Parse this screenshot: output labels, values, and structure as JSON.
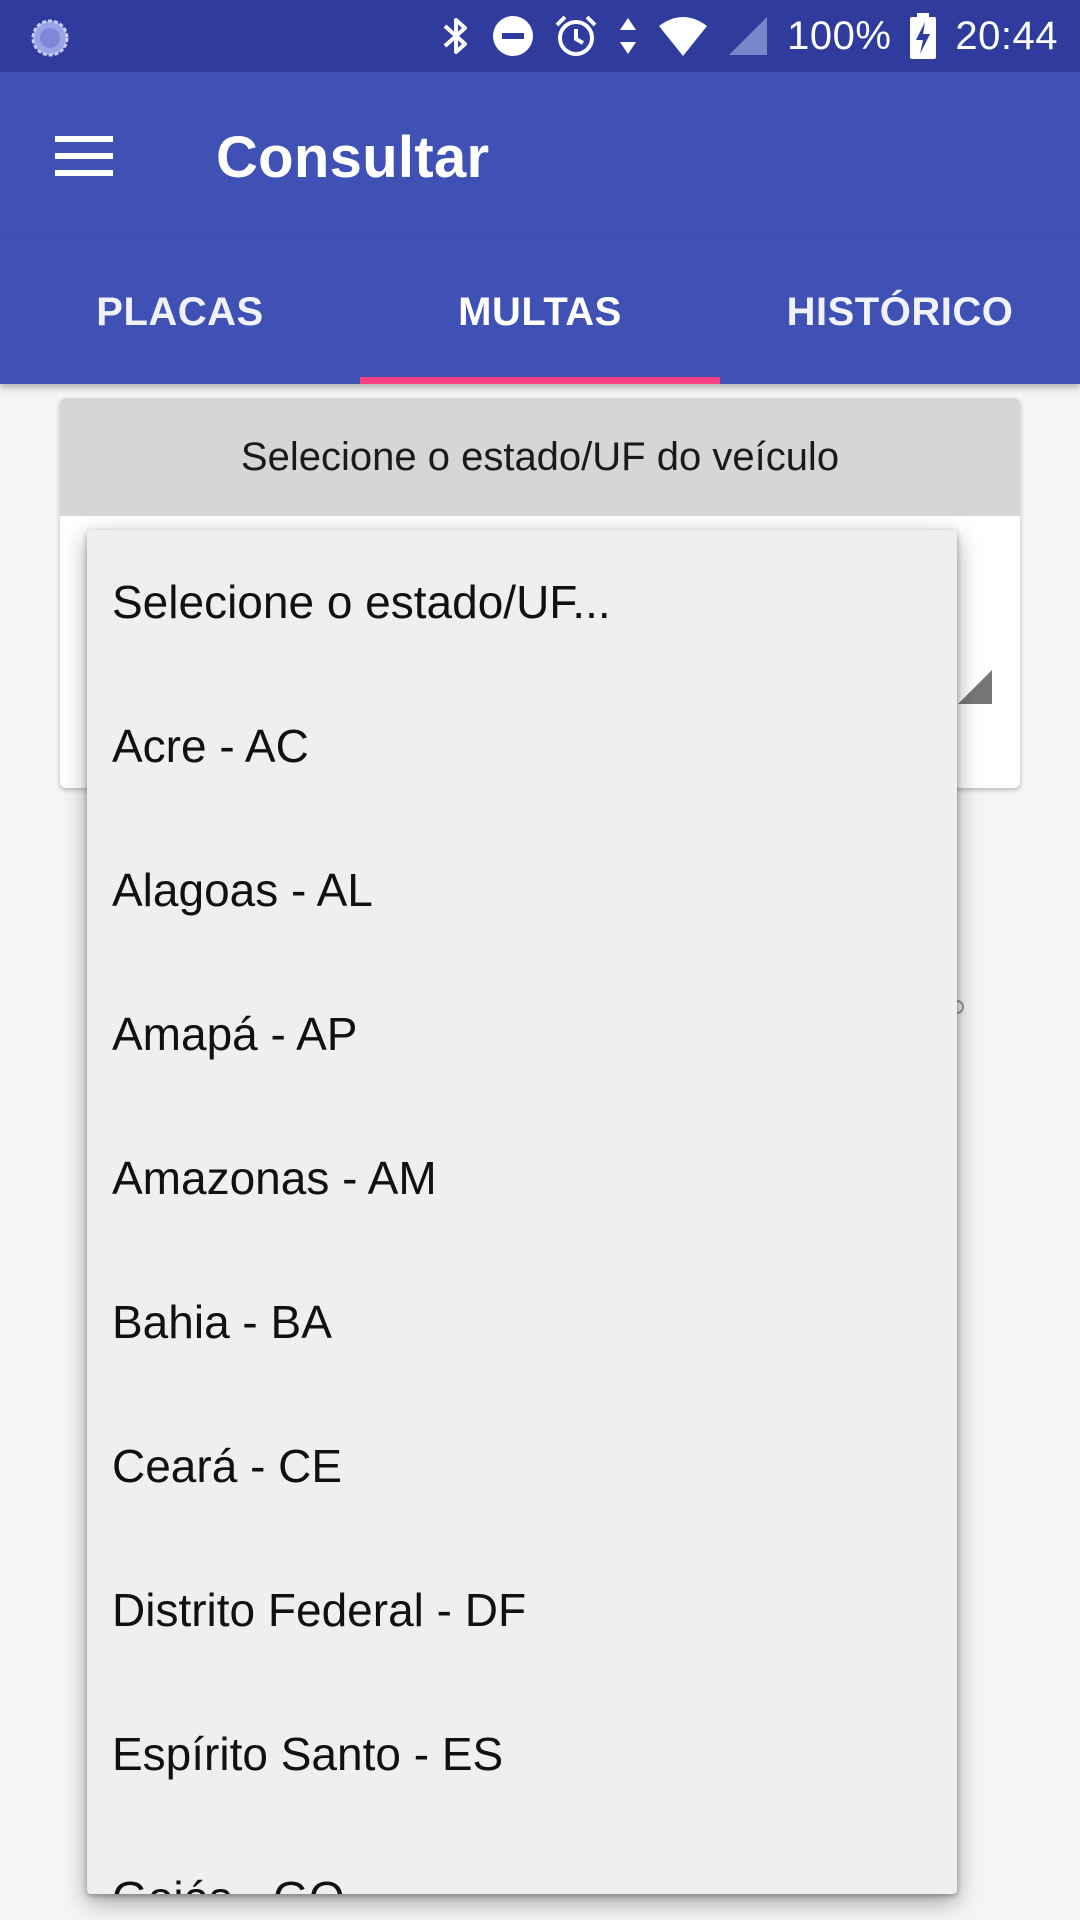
{
  "status_bar": {
    "battery": "100%",
    "time": "20:44"
  },
  "app_bar": {
    "title": "Consultar"
  },
  "tabs": [
    {
      "label": "PLACAS",
      "selected": false
    },
    {
      "label": "MULTAS",
      "selected": true
    },
    {
      "label": "HISTÓRICO",
      "selected": false
    }
  ],
  "card": {
    "header": "Selecione o estado/UF do veículo"
  },
  "dropdown": {
    "items": [
      "Selecione o estado/UF...",
      "Acre - AC",
      "Alagoas - AL",
      "Amapá - AP",
      "Amazonas - AM",
      "Bahia - BA",
      "Ceará - CE",
      "Distrito Federal - DF",
      "Espírito Santo - ES",
      "Goiás - GO"
    ]
  },
  "colors": {
    "primary": "#3f51b5",
    "primary_dark": "#2f3c9e",
    "accent": "#ff4081"
  }
}
